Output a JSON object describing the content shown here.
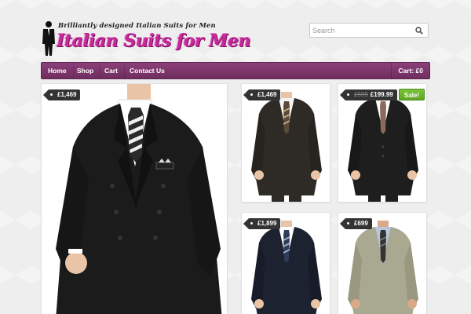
{
  "header": {
    "logo_tagline": "Brilliantly designed Italian Suits for Men",
    "logo_title": "Italian Suits for Men"
  },
  "search": {
    "placeholder": "Search"
  },
  "nav": {
    "items": [
      {
        "label": "Home"
      },
      {
        "label": "Shop"
      },
      {
        "label": "Cart"
      },
      {
        "label": "Contact Us"
      }
    ],
    "cart_label": "Cart: £0"
  },
  "products": [
    {
      "price": "£1,469",
      "suit_color": "#1c1c1c",
      "shirt": "#ffffff",
      "tie": "#2a2a2a"
    },
    {
      "price": "£1,469",
      "suit_color": "#2e2a26",
      "shirt": "#f4f4f4",
      "tie": "#5a4a3a"
    },
    {
      "old_price": "£599",
      "price": "£199.99",
      "sale_label": "Sale!",
      "suit_color": "#1e1e1e",
      "shirt": "#ffffff",
      "tie": "#8a6a5a"
    },
    {
      "price": "£1,899",
      "suit_color": "#1d2230",
      "shirt": "#ffffff",
      "tie": "#2e3b5a"
    },
    {
      "price": "£699",
      "suit_color": "#a9a891",
      "shirt": "#b8c8dc",
      "tie": "#333333"
    }
  ],
  "colors": {
    "accent": "#7b3369",
    "logo_pink": "#c7299b",
    "sale_green": "#6cb52e",
    "tag_dark": "#333333"
  }
}
